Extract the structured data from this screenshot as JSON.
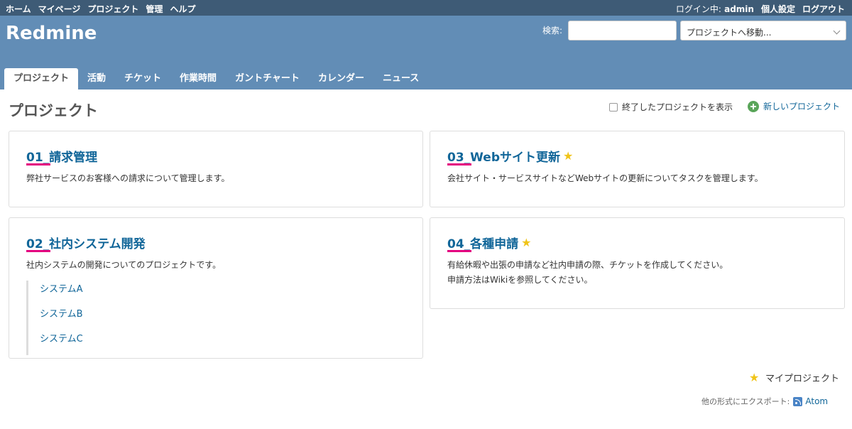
{
  "top_menu": {
    "items": [
      "ホーム",
      "マイページ",
      "プロジェクト",
      "管理",
      "ヘルプ"
    ],
    "logged_in_label": "ログイン中:",
    "user": "admin",
    "personal_settings": "個人設定",
    "logout": "ログアウト"
  },
  "header": {
    "app_title": "Redmine",
    "search_label": "検索:",
    "search_value": "",
    "project_jump": "プロジェクトへ移動..."
  },
  "main_menu": {
    "tabs": [
      "プロジェクト",
      "活動",
      "チケット",
      "作業時間",
      "ガントチャート",
      "カレンダー",
      "ニュース"
    ],
    "selected": "プロジェクト"
  },
  "page": {
    "title": "プロジェクト",
    "show_closed": "終了したプロジェクトを表示",
    "new_project": "新しいプロジェクト"
  },
  "projects": [
    {
      "name": "01_請求管理",
      "starred": false,
      "description": [
        "弊社サービスのお客様への請求について管理します。"
      ]
    },
    {
      "name": "03_Webサイト更新",
      "starred": true,
      "description": [
        "会社サイト・サービスサイトなどWebサイトの更新についてタスクを管理します。"
      ]
    },
    {
      "name": "02_社内システム開発",
      "starred": false,
      "description": [
        "社内システムの開発についてのプロジェクトです。"
      ],
      "subprojects": [
        "システムA",
        "システムB",
        "システムC"
      ]
    },
    {
      "name": "04_各種申請",
      "starred": true,
      "description": [
        "有給休暇や出張の申請など社内申請の際、チケットを作成してください。",
        "申請方法はWikiを参照してください。"
      ]
    }
  ],
  "footer": {
    "my_projects": "マイプロジェクト",
    "export_label": "他の形式にエクスポート:",
    "atom": "Atom"
  },
  "colors": {
    "top_bar": "#3e5b76",
    "header": "#628db6",
    "link": "#116699",
    "underline_accent": "#e4007f",
    "star": "#f0c419"
  }
}
